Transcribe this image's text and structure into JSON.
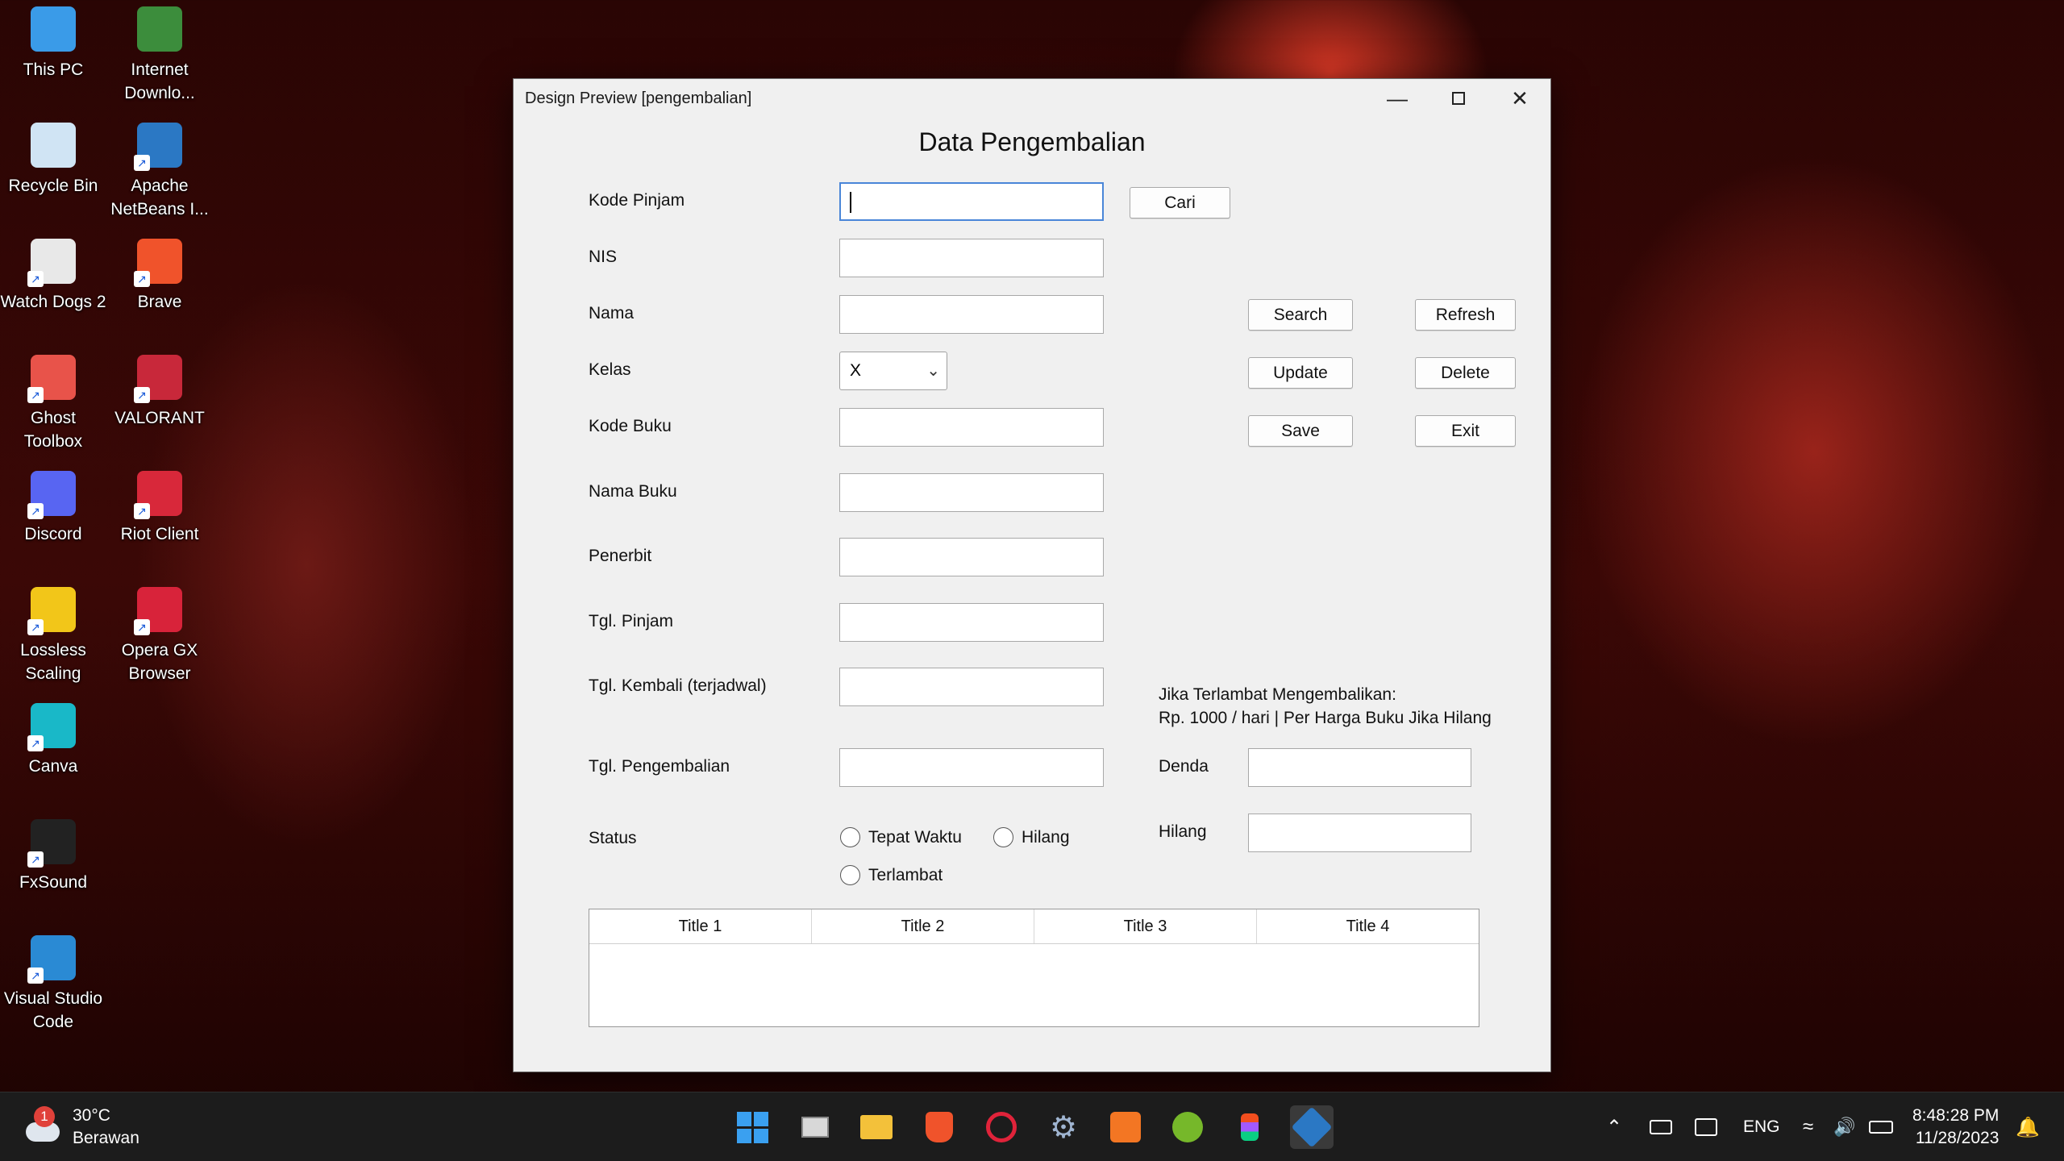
{
  "desktop": {
    "icons": [
      {
        "label": "This PC",
        "icon": "this-pc-icon",
        "color": "#3a9be8"
      },
      {
        "label": "Internet Downlo...",
        "icon": "internet-download-manager-icon",
        "color": "#3c8d3c"
      },
      {
        "label": "Recycle Bin",
        "icon": "recycle-bin-icon",
        "color": "#d0e4f4"
      },
      {
        "label": "Apache NetBeans I...",
        "icon": "netbeans-icon",
        "color": "#2b78c4"
      },
      {
        "label": "Watch Dogs 2",
        "icon": "watch-dogs-icon",
        "color": "#e8e8e8"
      },
      {
        "label": "Brave",
        "icon": "brave-icon",
        "color": "#f0532b"
      },
      {
        "label": "Ghost Toolbox",
        "icon": "ghost-toolbox-icon",
        "color": "#e8534a"
      },
      {
        "label": "VALORANT",
        "icon": "valorant-icon",
        "color": "#c8283a"
      },
      {
        "label": "Discord",
        "icon": "discord-icon",
        "color": "#5865f2"
      },
      {
        "label": "Riot Client",
        "icon": "riot-client-icon",
        "color": "#d8283a"
      },
      {
        "label": "Lossless Scaling",
        "icon": "lossless-scaling-icon",
        "color": "#f2c619"
      },
      {
        "label": "Opera GX Browser",
        "icon": "opera-gx-icon",
        "color": "#d8233a"
      },
      {
        "label": "Canva",
        "icon": "canva-icon",
        "color": "#19b8c8"
      },
      {
        "label": "FxSound",
        "icon": "fxsound-icon",
        "color": "#222222"
      },
      {
        "label": "Visual Studio Code",
        "icon": "vscode-icon",
        "color": "#2a8ad4"
      }
    ]
  },
  "window": {
    "title": "Design Preview [pengembalian]",
    "form_title": "Data Pengembalian",
    "labels": {
      "kode_pinjam": "Kode Pinjam",
      "nis": "NIS",
      "nama": "Nama",
      "kelas": "Kelas",
      "kode_buku": "Kode Buku",
      "nama_buku": "Nama Buku",
      "penerbit": "Penerbit",
      "tgl_pinjam": "Tgl. Pinjam",
      "tgl_kembali": "Tgl. Kembali (terjadwal)",
      "tgl_pengembalian": "Tgl. Pengembalian",
      "status": "Status",
      "denda": "Denda",
      "hilang": "Hilang"
    },
    "info_line1": "Jika Terlambat Mengembalikan:",
    "info_line2": "Rp. 1000 / hari | Per Harga Buku Jika Hilang",
    "kelas_value": "X",
    "buttons": {
      "cari": "Cari",
      "search": "Search",
      "refresh": "Refresh",
      "update": "Update",
      "delete": "Delete",
      "save": "Save",
      "exit": "Exit"
    },
    "status_options": {
      "tepat_waktu": "Tepat Waktu",
      "hilang": "Hilang",
      "terlambat": "Terlambat"
    },
    "table_headers": [
      "Title 1",
      "Title 2",
      "Title 3",
      "Title 4"
    ]
  },
  "taskbar": {
    "weather_temp": "30°C",
    "weather_desc": "Berawan",
    "weather_badge": "1",
    "language": "ENG",
    "time": "8:48:28 PM",
    "date": "11/28/2023"
  }
}
